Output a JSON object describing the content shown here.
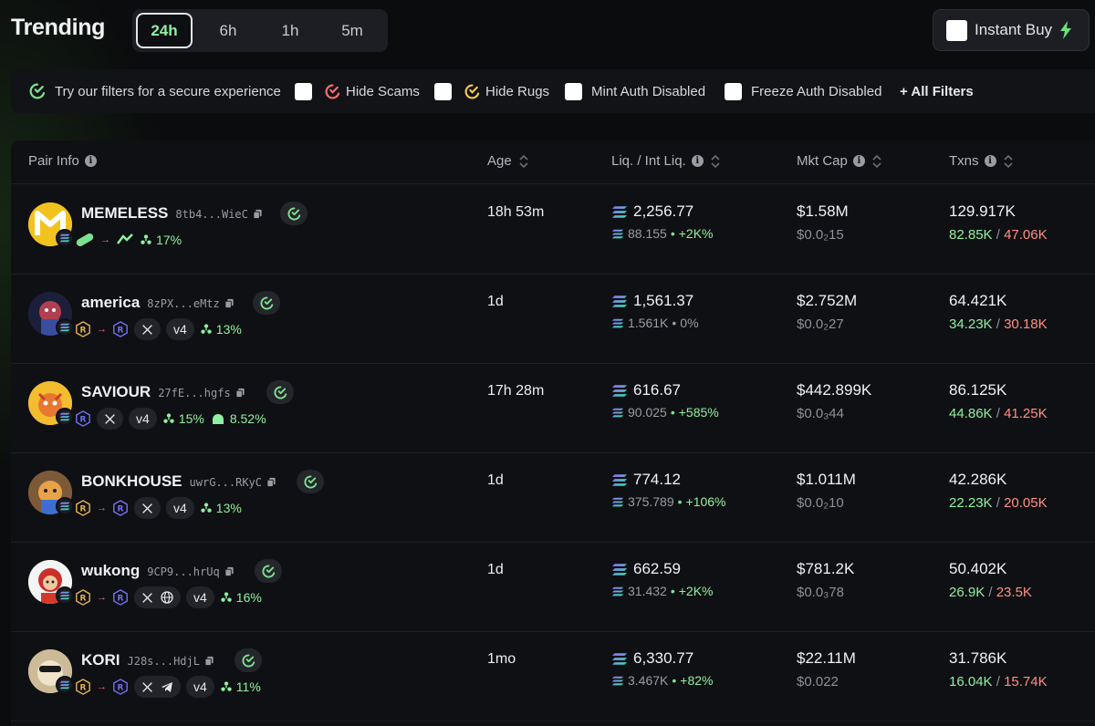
{
  "header": {
    "title": "Trending",
    "timeframes": [
      "24h",
      "6h",
      "1h",
      "5m"
    ],
    "active_timeframe": "24h",
    "instant_buy_label": "Instant Buy"
  },
  "filters": {
    "hint": "Try our filters for a secure experience",
    "options": [
      "Hide Scams",
      "Hide Rugs",
      "Mint Auth Disabled",
      "Freeze Auth Disabled"
    ],
    "all_filters": "+ All Filters"
  },
  "columns": [
    "Pair Info",
    "Age",
    "Liq. / Int Liq.",
    "Mkt Cap",
    "Txns"
  ],
  "colors": {
    "accent": "#8ef0a0",
    "sell": "#ff8f86",
    "background": "#0b0c0e"
  },
  "rows": [
    {
      "name": "MEMELESS",
      "addr": "8tb4...WieC",
      "age": "18h 53m",
      "liq": "2,256.77",
      "int_liq": "88.155",
      "liq_change": "+2K%",
      "mcap": "$1.58M",
      "price": "$0.0₂15",
      "txns": "129.917K",
      "buys": "82.85K",
      "sells": "47.06K",
      "holders_pct": "17%",
      "dex": "",
      "extra_pct": ""
    },
    {
      "name": "america",
      "addr": "8zPX...eMtz",
      "age": "1d",
      "liq": "1,561.37",
      "int_liq": "1.561K",
      "liq_change": "0%",
      "mcap": "$2.752M",
      "price": "$0.0₂27",
      "txns": "64.421K",
      "buys": "34.23K",
      "sells": "30.18K",
      "holders_pct": "13%",
      "dex": "v4",
      "extra_pct": ""
    },
    {
      "name": "SAVIOUR",
      "addr": "27fE...hgfs",
      "age": "17h 28m",
      "liq": "616.67",
      "int_liq": "90.025",
      "liq_change": "+585%",
      "mcap": "$442.899K",
      "price": "$0.0₃44",
      "txns": "86.125K",
      "buys": "44.86K",
      "sells": "41.25K",
      "holders_pct": "15%",
      "dex": "v4",
      "extra_pct": "8.52%"
    },
    {
      "name": "BONKHOUSE",
      "addr": "uwrG...RKyC",
      "age": "1d",
      "liq": "774.12",
      "int_liq": "375.789",
      "liq_change": "+106%",
      "mcap": "$1.011M",
      "price": "$0.0₂10",
      "txns": "42.286K",
      "buys": "22.23K",
      "sells": "20.05K",
      "holders_pct": "13%",
      "dex": "v4",
      "extra_pct": ""
    },
    {
      "name": "wukong",
      "addr": "9CP9...hrUq",
      "age": "1d",
      "liq": "662.59",
      "int_liq": "31.432",
      "liq_change": "+2K%",
      "mcap": "$781.2K",
      "price": "$0.0₃78",
      "txns": "50.402K",
      "buys": "26.9K",
      "sells": "23.5K",
      "holders_pct": "16%",
      "dex": "v4",
      "extra_pct": ""
    },
    {
      "name": "KORI",
      "addr": "J28s...HdjL",
      "age": "1mo",
      "liq": "6,330.77",
      "int_liq": "3.467K",
      "liq_change": "+82%",
      "mcap": "$22.11M",
      "price": "$0.022",
      "txns": "31.786K",
      "buys": "16.04K",
      "sells": "15.74K",
      "holders_pct": "11%",
      "dex": "v4",
      "extra_pct": ""
    }
  ]
}
